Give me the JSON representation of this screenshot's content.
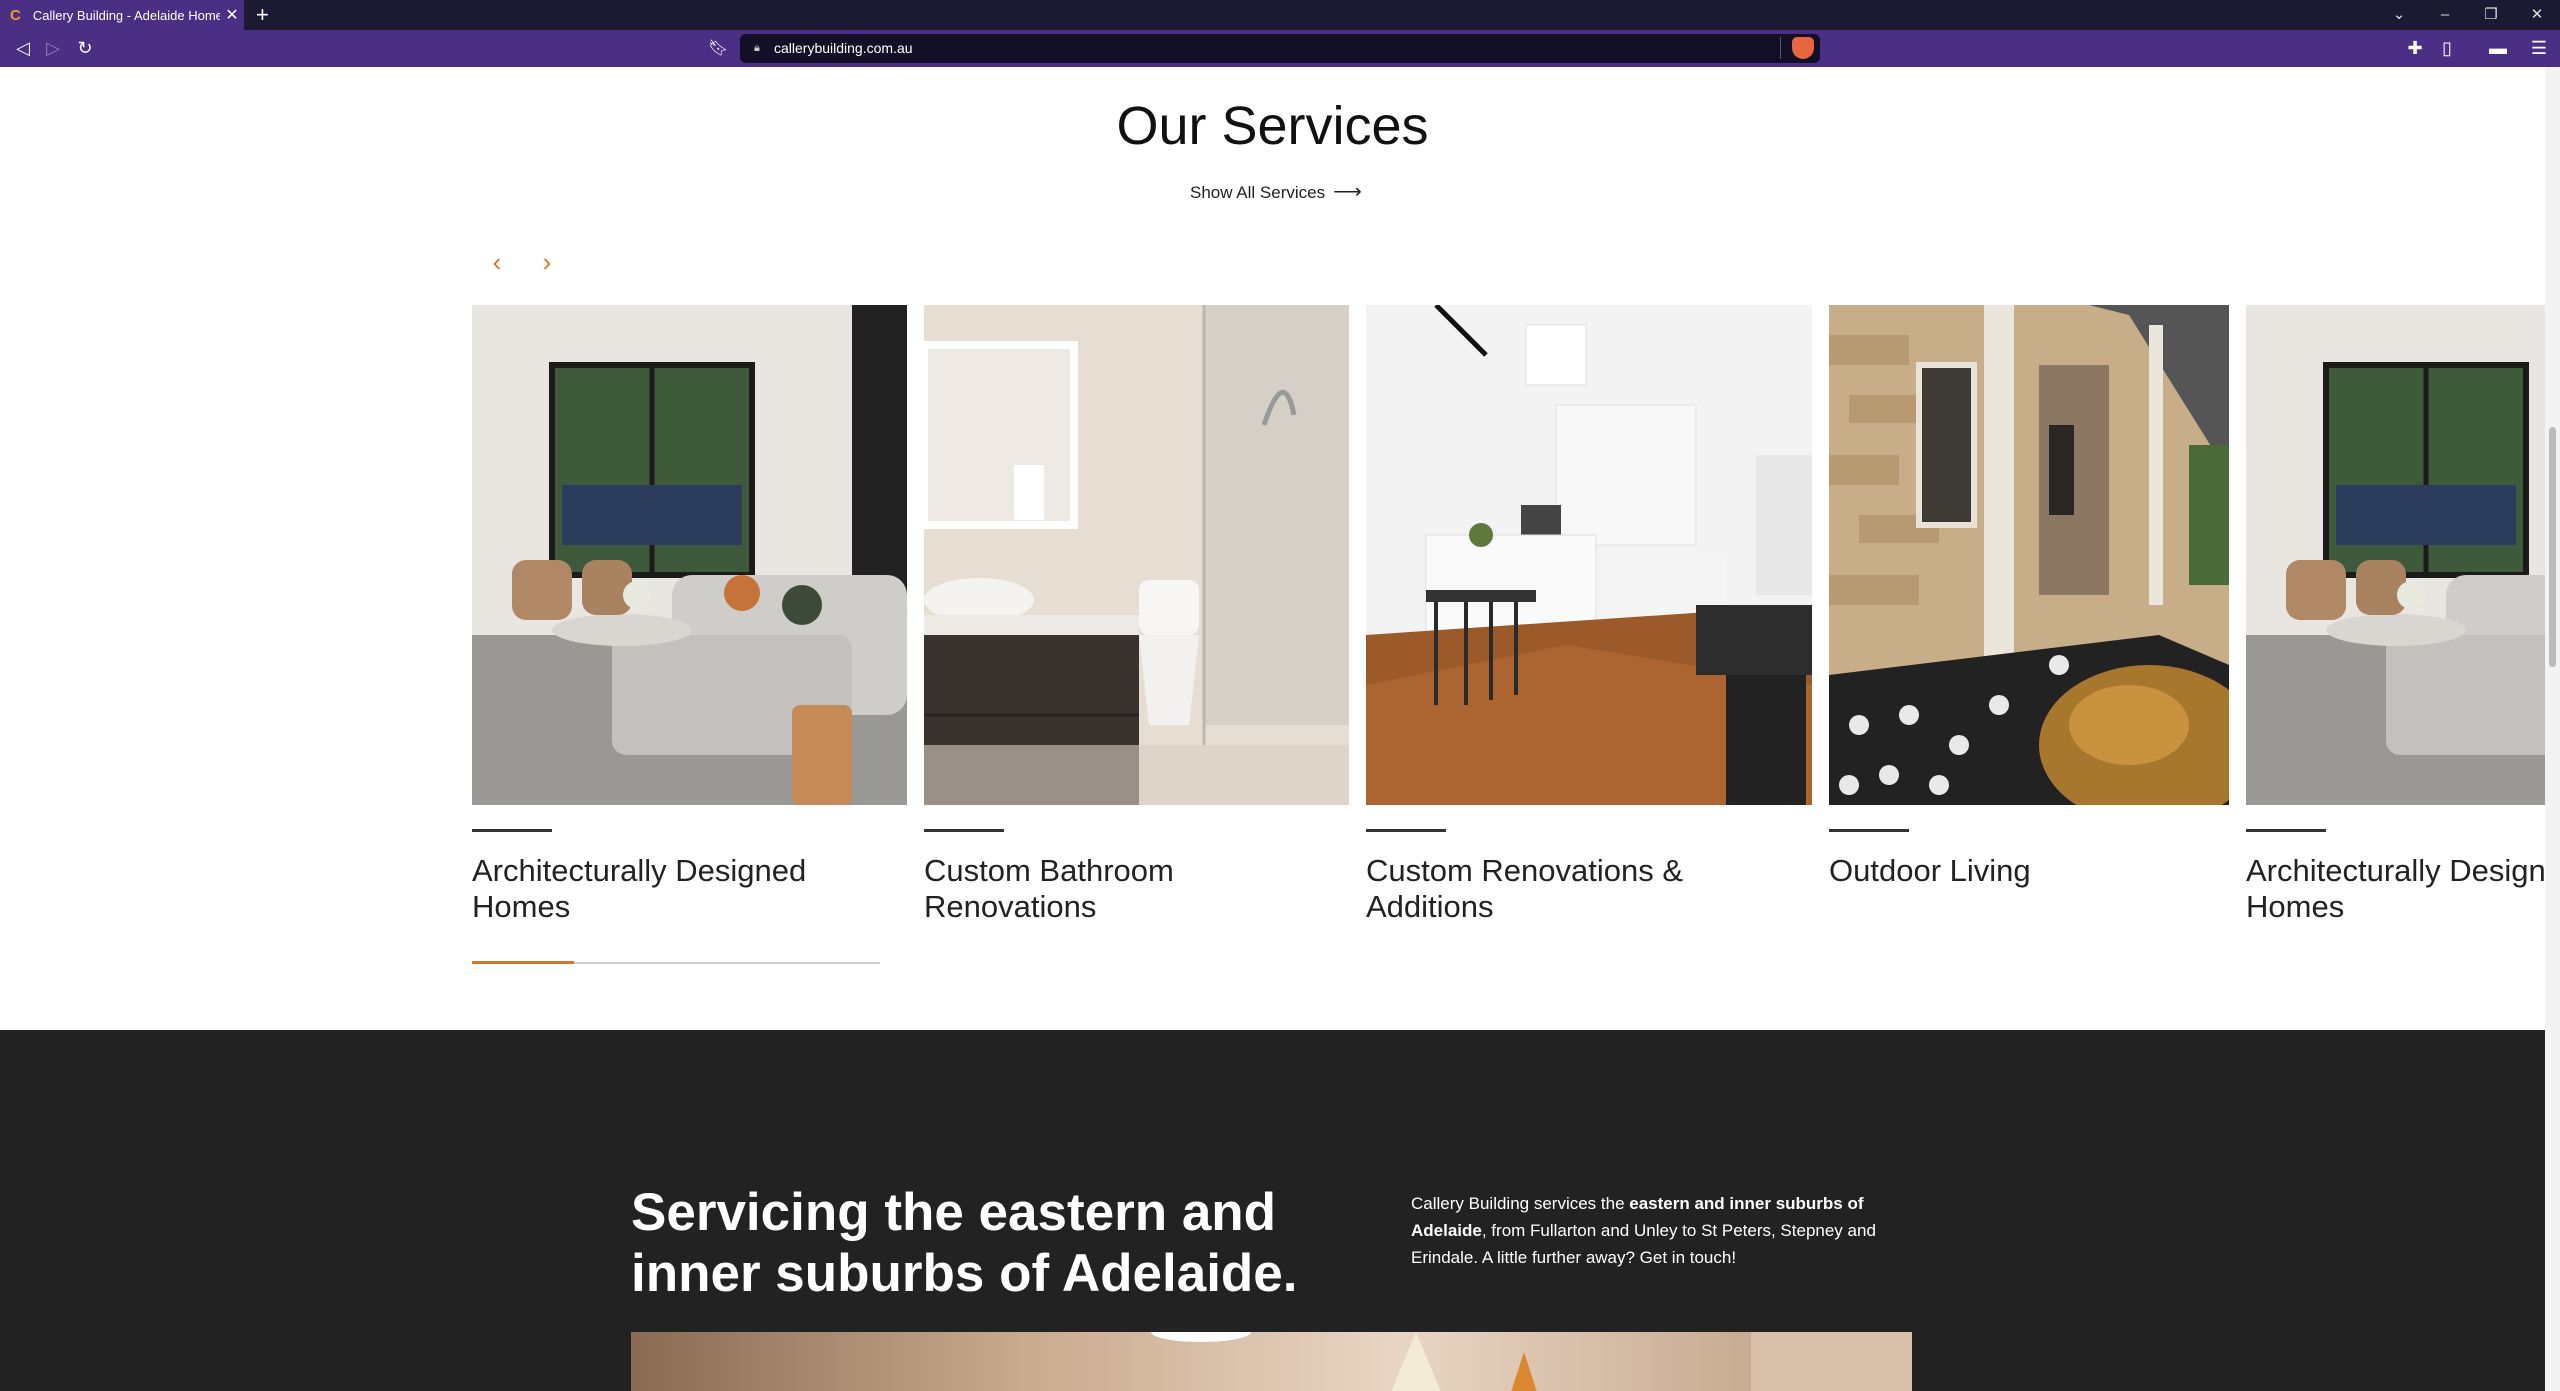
{
  "browser": {
    "tab_title": "Callery Building - Adelaide Home",
    "tab_favicon": "C",
    "url": "callerybuilding.com.au"
  },
  "services": {
    "title": "Our Services",
    "show_all": "Show All Services",
    "cards": [
      {
        "name": "Architecturally Designed Homes"
      },
      {
        "name": "Custom Bathroom Renovations"
      },
      {
        "name": "Custom Renovations & Additions"
      },
      {
        "name": "Outdoor Living"
      },
      {
        "name": "Architecturally Designed Homes"
      }
    ],
    "progress_fraction": 0.25
  },
  "region": {
    "heading": "Servicing the eastern and inner suburbs of Adelaide.",
    "text_pre": "Callery Building services the ",
    "text_bold": "eastern and inner suburbs of Adelaide",
    "text_post": ", from Fullarton and Unley to St Peters, Stepney and Erindale. A little further away? Get in touch!"
  },
  "colors": {
    "accent": "#d4762a",
    "browser_purple": "#4a2f84",
    "dark_section": "#232222"
  }
}
